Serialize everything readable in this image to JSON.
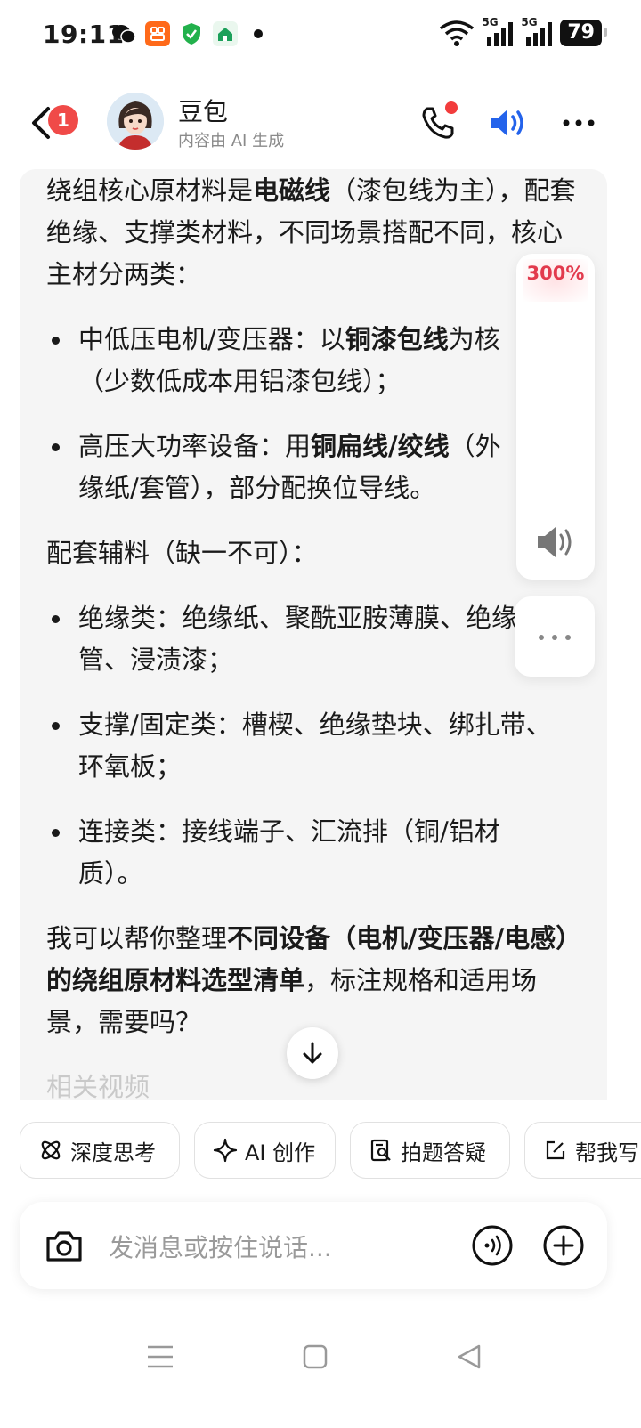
{
  "status_bar": {
    "time": "19:11",
    "battery": "79",
    "network": "5G"
  },
  "header": {
    "unread_count": "1",
    "title": "豆包",
    "subtitle": "内容由 AI 生成"
  },
  "message": {
    "intro": [
      "绕组核心原材料是",
      "电磁线",
      "（漆包线为主），配套绝缘、支撑类材料，不同场景搭配不同，核心主材分两类："
    ],
    "main_items": [
      [
        "中低压电机/变压器：以",
        "铜漆包线",
        "为核",
        "（少数低成本用铝漆包线）；"
      ],
      [
        "高压大功率设备：用",
        "铜扁线/绞线",
        "（外",
        "缘纸/套管），部分配换位导线。"
      ]
    ],
    "aux_heading": "配套辅料（缺一不可）：",
    "aux_items": [
      [
        "绝缘类：绝缘纸、聚酰亚胺薄膜、绝缘",
        "管、浸渍漆；"
      ],
      [
        "支撑/固定类：槽楔、绝缘垫块、绑扎带、",
        "环氧板；"
      ],
      [
        "连接类：接线端子、汇流排（铜/铝材",
        "质）。"
      ]
    ],
    "offer": [
      "我可以帮你整理",
      "不同设备（电机/变压器/电感）的绕组原材料选型清单",
      "，标注规格和适用场景，需要吗？"
    ],
    "related": "相关视频"
  },
  "float_panel": {
    "speed": "300%"
  },
  "chips": [
    {
      "label": "深度思考",
      "icon": "atom-icon"
    },
    {
      "label": "AI 创作",
      "icon": "sparkle-icon"
    },
    {
      "label": "拍题答疑",
      "icon": "scan-doc-icon"
    },
    {
      "label": "帮我写",
      "icon": "edit-icon"
    }
  ],
  "input": {
    "placeholder": "发消息或按住说话..."
  },
  "colors": {
    "accent_blue": "#2463eb",
    "badge_red": "#f04a48",
    "speed_red": "#e23a4d"
  }
}
